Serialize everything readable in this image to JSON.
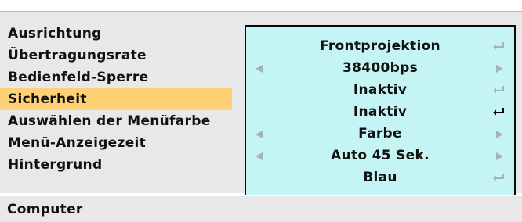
{
  "menu": {
    "items": [
      {
        "label": "Ausrichtung",
        "value": "Frontprojektion",
        "control": "enter",
        "selected": false
      },
      {
        "label": "Übertragungsrate",
        "value": "38400bps",
        "control": "arrows",
        "selected": false
      },
      {
        "label": "Bedienfeld-Sperre",
        "value": "Inaktiv",
        "control": "enter",
        "selected": false
      },
      {
        "label": "Sicherheit",
        "value": "Inaktiv",
        "control": "enter",
        "selected": true
      },
      {
        "label": "Auswählen der Menüfarbe",
        "value": "Farbe",
        "control": "arrows",
        "selected": false
      },
      {
        "label": "Menü-Anzeigezeit",
        "value": "Auto 45 Sek.",
        "control": "arrows",
        "selected": false
      },
      {
        "label": "Hintergrund",
        "value": "Blau",
        "control": "enter",
        "selected": false
      }
    ]
  },
  "status_bar": {
    "text": "Computer"
  },
  "icons": {
    "left": "arrow-left-icon",
    "right": "arrow-right-icon",
    "enter": "enter-icon"
  },
  "colors": {
    "value_box_bg": "#c4f4f4",
    "selected_row_bg": "#ffd176",
    "panel_bg": "#e8e8e8",
    "inactive_icon": "#a8b4b4",
    "active_icon": "#000000"
  }
}
